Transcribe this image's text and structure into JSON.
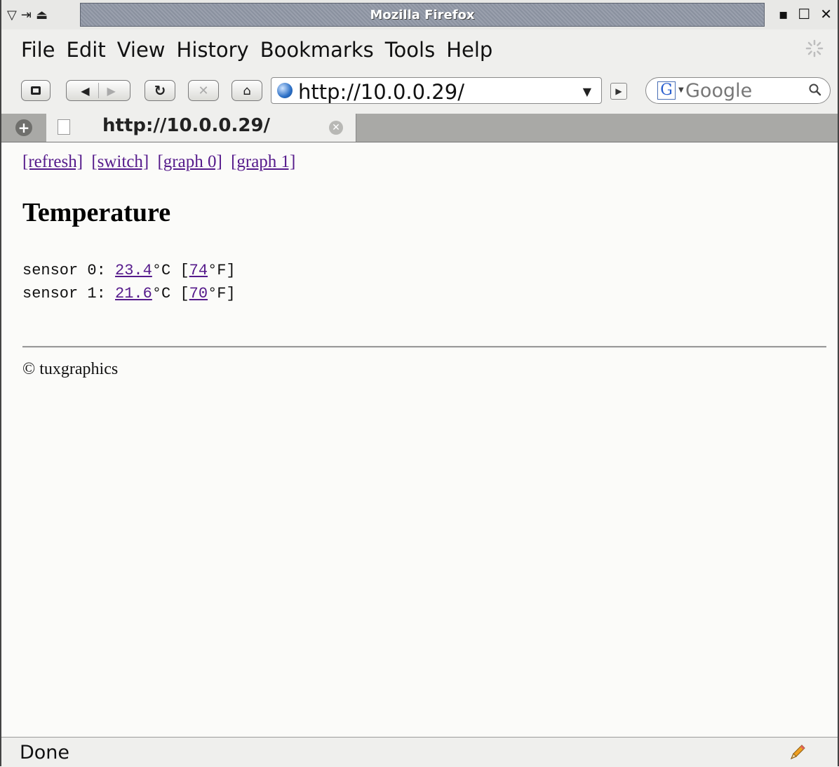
{
  "window": {
    "title": "Mozilla Firefox",
    "left_controls": [
      "▽",
      "⇥",
      "⏏"
    ],
    "right_controls": [
      "▪",
      "☐",
      "✕"
    ]
  },
  "menu": {
    "items": [
      "File",
      "Edit",
      "View",
      "History",
      "Bookmarks",
      "Tools",
      "Help"
    ]
  },
  "navbar": {
    "url": "http://10.0.0.29/",
    "search_placeholder": "Google"
  },
  "tabs": [
    {
      "label": "http://10.0.0.29/"
    }
  ],
  "page": {
    "links": [
      "[refresh]",
      "[switch]",
      "[graph 0]",
      "[graph 1]"
    ],
    "heading": "Temperature",
    "sensors": [
      {
        "label": "sensor 0:",
        "celsius": "23.4",
        "c_unit": "°C [",
        "fahrenheit": "74",
        "f_unit": "°F]"
      },
      {
        "label": "sensor 1:",
        "celsius": "21.6",
        "c_unit": "°C [",
        "fahrenheit": "70",
        "f_unit": "°F]"
      }
    ],
    "footer": "© tuxgraphics"
  },
  "status": {
    "text": "Done"
  },
  "colors": {
    "link": "#551a8b",
    "titlebar": "#8a919f"
  }
}
